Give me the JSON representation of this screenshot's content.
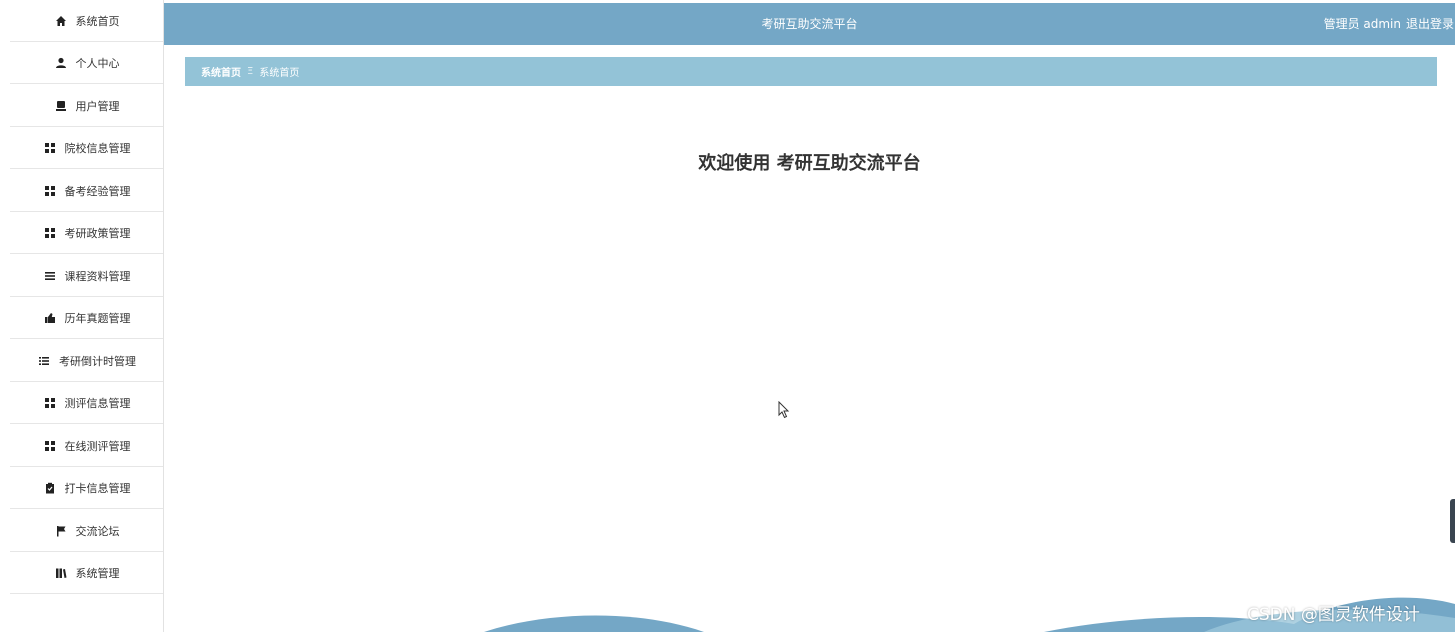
{
  "header": {
    "title": "考研互助交流平台",
    "user_text": "管理员 admin",
    "logout_label": "退出登录"
  },
  "sidebar": {
    "items": [
      {
        "label": "系统首页",
        "icon": "home-icon"
      },
      {
        "label": "个人中心",
        "icon": "user-icon"
      },
      {
        "label": "用户管理",
        "icon": "user-card-icon"
      },
      {
        "label": "院校信息管理",
        "icon": "grid-icon"
      },
      {
        "label": "备考经验管理",
        "icon": "grid-icon"
      },
      {
        "label": "考研政策管理",
        "icon": "grid-icon"
      },
      {
        "label": "课程资料管理",
        "icon": "list-icon"
      },
      {
        "label": "历年真题管理",
        "icon": "thumbs-icon"
      },
      {
        "label": "考研倒计时管理",
        "icon": "list-indent-icon"
      },
      {
        "label": "测评信息管理",
        "icon": "grid-icon"
      },
      {
        "label": "在线测评管理",
        "icon": "grid-icon"
      },
      {
        "label": "打卡信息管理",
        "icon": "clipboard-icon"
      },
      {
        "label": "交流论坛",
        "icon": "flag-icon"
      },
      {
        "label": "系统管理",
        "icon": "book-icon"
      }
    ]
  },
  "breadcrumb": {
    "home": "系统首页",
    "separator": "Ξ",
    "current": "系统首页"
  },
  "main": {
    "welcome": "欢迎使用 考研互助交流平台"
  },
  "watermark": "CSDN @图灵软件设计",
  "colors": {
    "topbar": "#74a7c6",
    "breadcrumb": "#93c3d7",
    "wave": "#74a7c6"
  }
}
